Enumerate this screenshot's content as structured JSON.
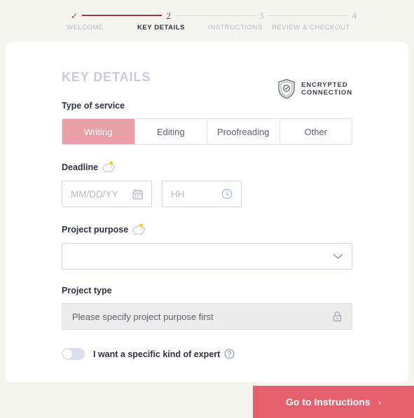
{
  "stepper": {
    "steps": [
      {
        "marker": "✓",
        "label": "WELCOME",
        "state": "done"
      },
      {
        "marker": "2",
        "label": "KEY DETAILS",
        "state": "current"
      },
      {
        "marker": "3",
        "label": "INSTRUCTIONS",
        "state": "upcoming"
      },
      {
        "marker": "4",
        "label": "REVIEW & CHECKOUT",
        "state": "upcoming"
      }
    ]
  },
  "card": {
    "title": "KEY DETAILS",
    "encrypted_badge": {
      "line1": "ENCRYPTED",
      "line2": "CONNECTION",
      "icon": "shield-check-icon"
    },
    "service": {
      "label": "Type of service",
      "tabs": [
        {
          "label": "Writing",
          "active": true
        },
        {
          "label": "Editing",
          "active": false
        },
        {
          "label": "Proofreading",
          "active": false
        },
        {
          "label": "Other",
          "active": false
        }
      ]
    },
    "deadline": {
      "label": "Deadline",
      "icon": "piggy-bank-icon",
      "date_placeholder": "MM/DD/YY",
      "date_value": "",
      "date_icon": "calendar-icon",
      "time_placeholder": "HH",
      "time_value": "",
      "time_icon": "clock-icon"
    },
    "project_purpose": {
      "label": "Project purpose",
      "icon": "piggy-bank-icon",
      "value": "",
      "placeholder": "",
      "chevron": "chevron-down-icon"
    },
    "project_type": {
      "label": "Project type",
      "value": "Please specify project purpose first",
      "icon": "lock-icon",
      "disabled": true
    },
    "expert_toggle": {
      "label": "I want a specific kind of expert",
      "help_icon": "question-circle-icon",
      "enabled": false
    }
  },
  "footer": {
    "cta_label": "Go to Instructions",
    "cta_chevron": "›"
  },
  "colors": {
    "page_bg": "#f5f5f0",
    "accent_red": "#e5606f",
    "step_done": "#9e3642",
    "tab_active": "#e8a0a6",
    "muted": "#b7b9ca"
  }
}
